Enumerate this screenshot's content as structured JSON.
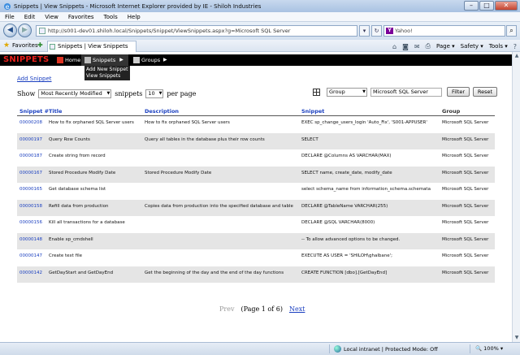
{
  "window": {
    "title": "Snippets | View Snippets - Microsoft Internet Explorer provided by IE - Shiloh Industries",
    "minimize": "–",
    "maximize": "□",
    "close": "✕"
  },
  "menu": [
    "File",
    "Edit",
    "View",
    "Favorites",
    "Tools",
    "Help"
  ],
  "address": {
    "url": "http://s001-dev01.shiloh.local/Snippets/Snippet/ViewSnippets.aspx?g=Microsoft SQL Server",
    "search_placeholder": "Yahoo!"
  },
  "favorites": {
    "label": "Favorites",
    "tab_title": "Snippets | View Snippets",
    "commands": [
      "Page ▾",
      "Safety ▾",
      "Tools ▾"
    ]
  },
  "site": {
    "brand": "SNIPPETS",
    "nav": {
      "home": "Home",
      "snippets": "Snippets",
      "groups": "Groups"
    },
    "dropdown": [
      "Add New Snippet",
      "View Snippets"
    ],
    "add_link": "Add Snippet"
  },
  "controls": {
    "show_label": "Show",
    "sort_value": "Most Recently Modified",
    "snippets_label": "snippets",
    "count_value": "10",
    "per_page_label": "per page",
    "group_select": "Group",
    "filter_value": "Microsoft SQL Server",
    "filter_button": "Filter",
    "reset_button": "Reset"
  },
  "table": {
    "headers": {
      "id": "Snippet #",
      "title": "Title",
      "description": "Description",
      "snippet": "Snippet",
      "group": "Group"
    },
    "rows": [
      {
        "id": "00000208",
        "title": "How to fix orphaned SQL Server users",
        "description": "How to fix orphaned SQL Server users",
        "snippet": "EXEC sp_change_users_login 'Auto_Fix', 'S001-APPUSER'",
        "group": "Microsoft SQL Server"
      },
      {
        "id": "00000197",
        "title": "Query Row Counts",
        "description": "Query all tables in the database plus their row counts",
        "snippet": "SELECT",
        "group": "Microsoft SQL Server"
      },
      {
        "id": "00000187",
        "title": "Create string from record",
        "description": "",
        "snippet": "DECLARE @Columns AS VARCHAR(MAX)",
        "group": "Microsoft SQL Server"
      },
      {
        "id": "00000167",
        "title": "Stored Procedure Modify Date",
        "description": "Stored Procedure Modify Date",
        "snippet": "SELECT name, create_date, modify_date",
        "group": "Microsoft SQL Server"
      },
      {
        "id": "00000165",
        "title": "Get database schema list",
        "description": "",
        "snippet": "select schema_name from information_schema.schemata",
        "group": "Microsoft SQL Server"
      },
      {
        "id": "00000158",
        "title": "Refill data from production",
        "description": "Copies data from production into the specified database and table",
        "snippet": "DECLARE @TableName VARCHAR(255)",
        "group": "Microsoft SQL Server"
      },
      {
        "id": "00000156",
        "title": "Kill all transactions for a database",
        "description": "",
        "snippet": "DECLARE @SQL VARCHAR(8000)",
        "group": "Microsoft SQL Server"
      },
      {
        "id": "00000148",
        "title": "Enable xp_cmdshell",
        "description": "",
        "snippet": "-- To allow advanced options to be changed.",
        "group": "Microsoft SQL Server"
      },
      {
        "id": "00000147",
        "title": "Create text file",
        "description": "",
        "snippet": "EXECUTE AS USER = 'SHILOH\\ghalbane';",
        "group": "Microsoft SQL Server"
      },
      {
        "id": "00000142",
        "title": "GetDayStart and GetDayEnd",
        "description": "Get the beginning of the day and the end of the day functions",
        "snippet": "CREATE FUNCTION [dbo].[GetDayEnd]",
        "group": "Microsoft SQL Server"
      }
    ]
  },
  "pager": {
    "prev": "Prev",
    "info": "(Page 1 of 6)",
    "next": "Next"
  },
  "status": {
    "zone": "Local intranet | Protected Mode: Off",
    "zoom": "100%"
  }
}
